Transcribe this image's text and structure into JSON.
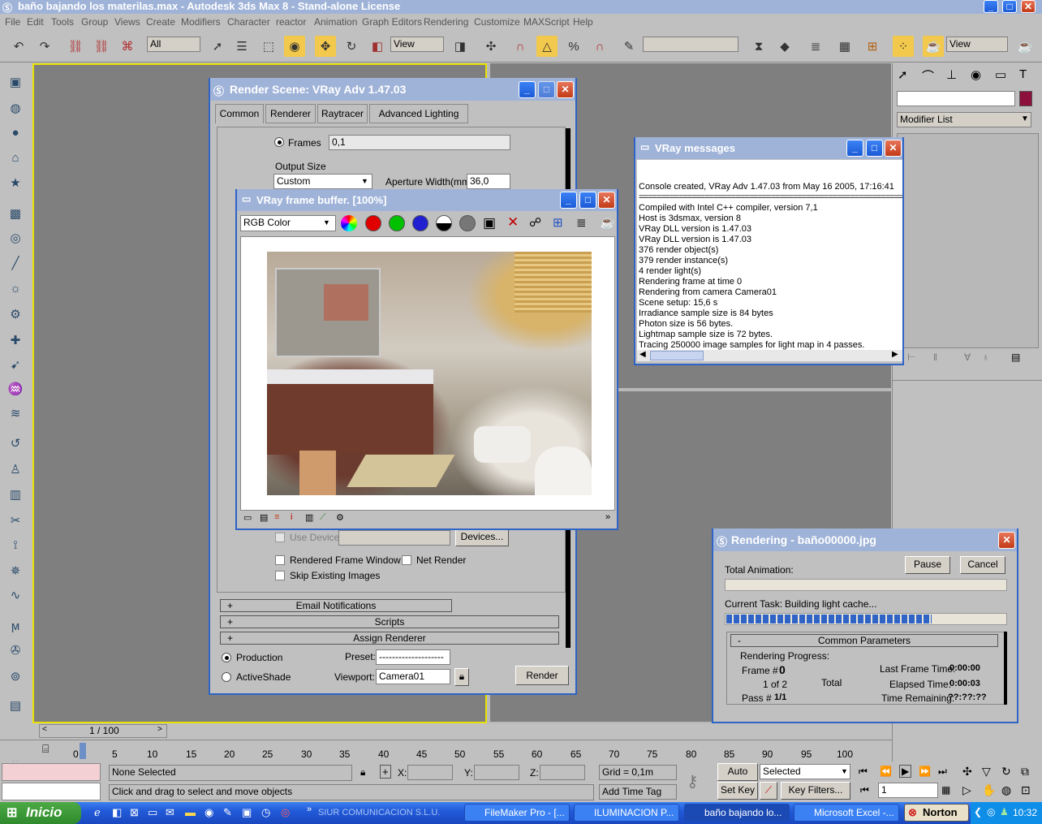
{
  "app": {
    "title": "baño bajando los materilas.max - Autodesk 3ds Max 8   - Stand-alone License",
    "menu": [
      "File",
      "Edit",
      "Tools",
      "Group",
      "Views",
      "Create",
      "Modifiers",
      "Character",
      "reactor",
      "Animation",
      "Graph Editors",
      "Rendering",
      "Customize",
      "MAXScript",
      "Help"
    ],
    "selection_filter": "All",
    "ref_coord": "View",
    "viewport_view": "View"
  },
  "command_panel": {
    "modifier_list": "Modifier List"
  },
  "render_scene": {
    "title": "Render Scene: VRay Adv 1.47.03",
    "tabs": [
      "Common",
      "Renderer",
      "Raytracer",
      "Advanced Lighting"
    ],
    "frames_label": "Frames",
    "frames_value": "0,1",
    "output_size_label": "Output Size",
    "output_size_value": "Custom",
    "aperture_label": "Aperture Width(mm):",
    "aperture_value": "36,0",
    "use_device": "Use Device",
    "devices_button": "Devices...",
    "rendered_frame_window": "Rendered Frame Window",
    "net_render": "Net Render",
    "skip_existing": "Skip Existing Images",
    "rollouts": [
      "Email Notifications",
      "Scripts",
      "Assign Renderer"
    ],
    "rollout_sign": "+",
    "production": "Production",
    "activeshade": "ActiveShade",
    "preset_label": "Preset:",
    "preset_value": "--------------------",
    "viewport_label": "Viewport:",
    "viewport_value": "Camera01",
    "render_button": "Render"
  },
  "frame_buffer": {
    "title": "VRay frame buffer. [100%]",
    "channel": "RGB Color"
  },
  "vray_messages": {
    "title": "VRay messages",
    "lines": [
      "",
      "Console created, VRay Adv 1.47.03 from May 16 2005, 17:16:41",
      "================================================================================",
      "Compiled with Intel C++ compiler, version 7,1",
      "Host is 3dsmax, version 8",
      "VRay DLL version is 1.47.03",
      "VRay DLL version is 1.47.03",
      "376 render object(s)",
      "379 render instance(s)",
      "4 render light(s)",
      "Rendering frame at time 0",
      "Rendering from camera Camera01",
      "Scene setup: 15,6 s",
      "Irradiance sample size is 84 bytes",
      "Photon size is 56 bytes.",
      "Lightmap sample size is 72 bytes.",
      "Tracing 250000 image samples for light map in 4 passes."
    ]
  },
  "rendering": {
    "title": "Rendering - baño00000.jpg",
    "pause": "Pause",
    "cancel": "Cancel",
    "total_animation": "Total Animation:",
    "current_task_label": "Current Task:",
    "current_task": "Building light cache...",
    "progress": 0.73,
    "common_parameters": "Common Parameters",
    "rollout_sign": "-",
    "rendering_progress": "Rendering Progress:",
    "frame_label": "Frame #",
    "frame_value": "0",
    "of_text": "1 of 2",
    "total": "Total",
    "pass_label": "Pass #",
    "pass_value": "1/1",
    "last_frame_time_label": "Last Frame Time:",
    "last_frame_time": "0:00:00",
    "elapsed_label": "Elapsed Time:",
    "elapsed": "0:00:03",
    "remaining_label": "Time Remaining:",
    "remaining": "??:??:??"
  },
  "timeline": {
    "frame_counter": "1 / 100",
    "ticks": [
      "0",
      "5",
      "10",
      "15",
      "20",
      "25",
      "30",
      "35",
      "40",
      "45",
      "50",
      "55",
      "60",
      "65",
      "70",
      "75",
      "80",
      "85",
      "90",
      "95",
      "100"
    ]
  },
  "status": {
    "selection": "None Selected",
    "prompt": "Click and drag to select and move objects",
    "x": "X:",
    "y": "Y:",
    "z": "Z:",
    "grid": "Grid = 0,1m",
    "add_time_tag": "Add Time Tag",
    "auto_key": "Auto Key",
    "set_key": "Set Key",
    "selected": "Selected",
    "key_filters": "Key Filters...",
    "current_frame": "1"
  },
  "taskbar": {
    "start": "Inicio",
    "tasks": [
      "SIUR COMUNICACION S.L.U.",
      "FileMaker Pro - [...",
      "ILUMINACION P...",
      "baño bajando lo...",
      "Microsoft Excel -..."
    ],
    "norton": "Norton",
    "clock": "10:32"
  }
}
